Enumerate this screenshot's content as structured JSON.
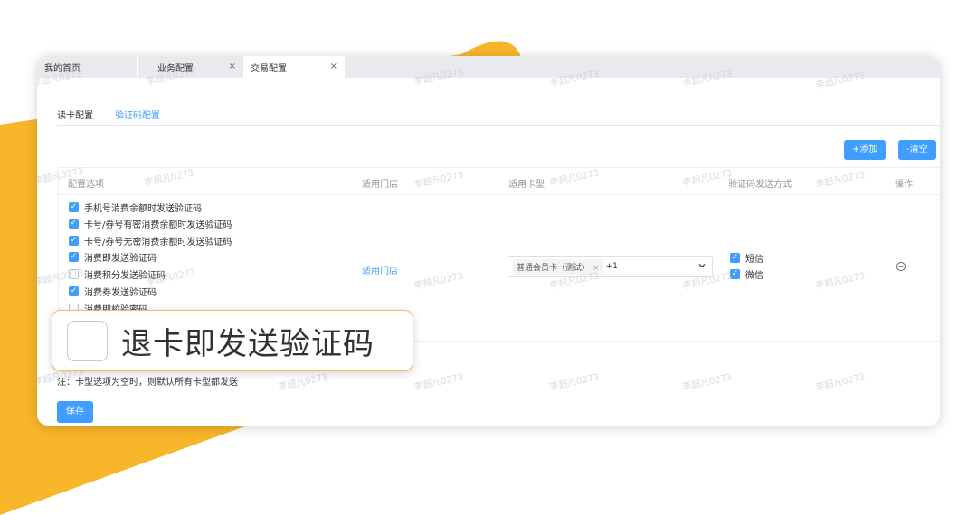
{
  "colors": {
    "accent": "#409eff",
    "brand_yellow": "#f8b62a",
    "checkbox_off_border": "#c0c4cc"
  },
  "window_tabs": [
    {
      "label": "我的首页",
      "closable": false
    },
    {
      "label": "业务配置",
      "closable": true,
      "close_glyph": "×"
    },
    {
      "label": "交易配置",
      "closable": true,
      "close_glyph": "×",
      "active": true
    }
  ],
  "sub_tabs": [
    {
      "label": "读卡配置",
      "active": false
    },
    {
      "label": "验证码配置",
      "active": true
    }
  ],
  "toolbar": {
    "add_label": "+添加",
    "clear_label": "-清空"
  },
  "table": {
    "headers": {
      "options": "配置选项",
      "stores": "适用门店",
      "card_types": "适用卡型",
      "send_methods": "验证码发送方式",
      "actions": "操作"
    },
    "options": [
      {
        "label": "手机号消费余额时发送验证码",
        "checked": true
      },
      {
        "label": "卡号/券号有密消费余额时发送验证码",
        "checked": true
      },
      {
        "label": "卡号/券号无密消费余额时发送验证码",
        "checked": true
      },
      {
        "label": "消费即发送验证码",
        "checked": true
      },
      {
        "label": "消费积分发送验证码",
        "checked": false
      },
      {
        "label": "消费券发送验证码",
        "checked": true
      },
      {
        "label": "消费即校验密码",
        "checked": false
      }
    ],
    "store_link": "适用门店",
    "card_select": {
      "tag": "普通会员卡（测试）",
      "tag_close": "×",
      "extra": "+1",
      "icon": "chevron-down-icon"
    },
    "send_methods": [
      {
        "label": "短信",
        "checked": true
      },
      {
        "label": "微信",
        "checked": true
      }
    ],
    "action_icon": "minus-circle-icon"
  },
  "note": "注：卡型选项为空时，则默认所有卡型都发送",
  "save_label": "保存",
  "watermark": "李超凡0273",
  "callout": {
    "label": "退卡即发送验证码",
    "checked": false
  },
  "check_glyph": "✓"
}
